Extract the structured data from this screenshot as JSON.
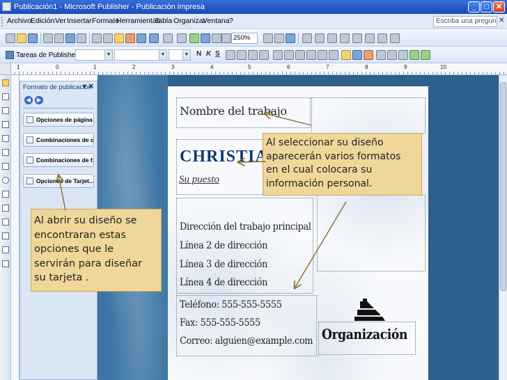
{
  "window": {
    "title": "Publicación1 - Microsoft Publisher - Publicación impresa",
    "minimize": "_",
    "maximize": "□",
    "close": "✕"
  },
  "menu": {
    "items": [
      "Archivo",
      "Edición",
      "Ver",
      "Insertar",
      "Formato",
      "Herramientas",
      "Tabla",
      "Organizar",
      "Ventana",
      "?"
    ],
    "search_placeholder": "Escriba una pregunta",
    "close_doc": "✕"
  },
  "toolbar": {
    "zoom": "250%",
    "tasks_label": "Tareas de Publisher",
    "format_letters": [
      "N",
      "K",
      "S"
    ]
  },
  "ruler": {
    "numbers": [
      "1",
      "0",
      "1",
      "2",
      "3",
      "4",
      "5",
      "6",
      "7",
      "8",
      "9",
      "10"
    ]
  },
  "taskpane": {
    "title": "Formato de publicación",
    "close": "▾ ✕",
    "buttons": [
      "Opciones de página",
      "Combinaciones de c...",
      "Combinaciones de f...",
      "Opciones de Tarjet..."
    ]
  },
  "card": {
    "job_title": "Nombre del trabajo",
    "name": "CHRISTIAN",
    "position": "Su puesto",
    "address": [
      "Dirección del trabajo principal",
      "Línea 2 de dirección",
      "Línea 3 de dirección",
      "Línea 4 de dirección"
    ],
    "contact": [
      "Teléfono: 555-555-5555",
      "Fax: 555-555-5555",
      "Correo: alguien@example.com"
    ],
    "organization": "Organización"
  },
  "callouts": {
    "right": [
      "Al seleccionar su diseño",
      "aparecerán varios formatos",
      "en el cual colocara su",
      "información personal."
    ],
    "left": [
      "Al abrir su diseño se",
      "encontraran estas",
      "opciones  que le",
      "servirán para diseñar",
      "su tarjeta ."
    ]
  },
  "colors": {
    "titlebar": "#2457c4",
    "workspace": "#2f5f8c",
    "callout": "#efd79a",
    "name_blue": "#123a6a"
  }
}
